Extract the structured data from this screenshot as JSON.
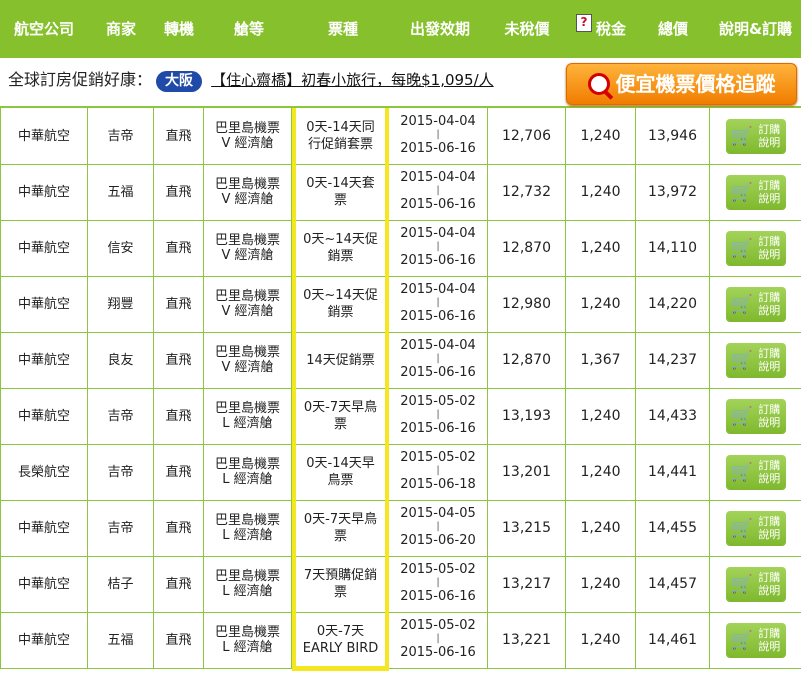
{
  "header": {
    "airline": "航空公司",
    "agent": "商家",
    "transfer": "轉機",
    "cabin": "艙等",
    "ticket_type": "票種",
    "validity": "出發效期",
    "pre_tax": "未稅價",
    "tax_icon": "?",
    "tax": "稅金",
    "total": "總價",
    "action": "說明&訂購"
  },
  "promo": {
    "prefix": "全球訂房促銷好康：",
    "city": "大阪",
    "link_text": "【住心齋橋】初春小旅行，每晚$1,095/人",
    "tracker_label": "便宜機票價格追蹤"
  },
  "accent": "#86c02c",
  "highlight_color": "#f5e71f",
  "rows": [
    {
      "airline": "中華航空",
      "agent": "吉帝",
      "transfer": "直飛",
      "cabin1": "巴里島機票",
      "cabin2": "V 經濟艙",
      "ticket": "0天-14天同行促銷套票",
      "from": "2015-04-04",
      "sep": "|",
      "to": "2015-06-16",
      "pre_tax": "12,706",
      "tax": "1,240",
      "total": "13,946",
      "btn_line1": "訂購",
      "btn_line2": "說明"
    },
    {
      "airline": "中華航空",
      "agent": "五福",
      "transfer": "直飛",
      "cabin1": "巴里島機票",
      "cabin2": "V 經濟艙",
      "ticket": "0天-14天套票",
      "from": "2015-04-04",
      "sep": "|",
      "to": "2015-06-16",
      "pre_tax": "12,732",
      "tax": "1,240",
      "total": "13,972",
      "btn_line1": "訂購",
      "btn_line2": "說明"
    },
    {
      "airline": "中華航空",
      "agent": "信安",
      "transfer": "直飛",
      "cabin1": "巴里島機票",
      "cabin2": "V 經濟艙",
      "ticket": "0天~14天促銷票",
      "from": "2015-04-04",
      "sep": "|",
      "to": "2015-06-16",
      "pre_tax": "12,870",
      "tax": "1,240",
      "total": "14,110",
      "btn_line1": "訂購",
      "btn_line2": "說明"
    },
    {
      "airline": "中華航空",
      "agent": "翔豐",
      "transfer": "直飛",
      "cabin1": "巴里島機票",
      "cabin2": "V 經濟艙",
      "ticket": "0天~14天促銷票",
      "from": "2015-04-04",
      "sep": "|",
      "to": "2015-06-16",
      "pre_tax": "12,980",
      "tax": "1,240",
      "total": "14,220",
      "btn_line1": "訂購",
      "btn_line2": "說明"
    },
    {
      "airline": "中華航空",
      "agent": "良友",
      "transfer": "直飛",
      "cabin1": "巴里島機票",
      "cabin2": "V 經濟艙",
      "ticket": "14天促銷票",
      "from": "2015-04-04",
      "sep": "|",
      "to": "2015-06-16",
      "pre_tax": "12,870",
      "tax": "1,367",
      "total": "14,237",
      "btn_line1": "訂購",
      "btn_line2": "說明"
    },
    {
      "airline": "中華航空",
      "agent": "吉帝",
      "transfer": "直飛",
      "cabin1": "巴里島機票",
      "cabin2": "L 經濟艙",
      "ticket": "0天-7天早鳥票",
      "from": "2015-05-02",
      "sep": "|",
      "to": "2015-06-16",
      "pre_tax": "13,193",
      "tax": "1,240",
      "total": "14,433",
      "btn_line1": "訂購",
      "btn_line2": "說明"
    },
    {
      "airline": "長榮航空",
      "agent": "吉帝",
      "transfer": "直飛",
      "cabin1": "巴里島機票",
      "cabin2": "L 經濟艙",
      "ticket": "0天-14天早鳥票",
      "from": "2015-05-02",
      "sep": "|",
      "to": "2015-06-18",
      "pre_tax": "13,201",
      "tax": "1,240",
      "total": "14,441",
      "btn_line1": "訂購",
      "btn_line2": "說明"
    },
    {
      "airline": "中華航空",
      "agent": "吉帝",
      "transfer": "直飛",
      "cabin1": "巴里島機票",
      "cabin2": "L 經濟艙",
      "ticket": "0天-7天早鳥票",
      "from": "2015-04-05",
      "sep": "|",
      "to": "2015-06-20",
      "pre_tax": "13,215",
      "tax": "1,240",
      "total": "14,455",
      "btn_line1": "訂購",
      "btn_line2": "說明"
    },
    {
      "airline": "中華航空",
      "agent": "桔子",
      "transfer": "直飛",
      "cabin1": "巴里島機票",
      "cabin2": "L 經濟艙",
      "ticket": "7天預購促銷票",
      "from": "2015-05-02",
      "sep": "|",
      "to": "2015-06-16",
      "pre_tax": "13,217",
      "tax": "1,240",
      "total": "14,457",
      "btn_line1": "訂購",
      "btn_line2": "說明"
    },
    {
      "airline": "中華航空",
      "agent": "五福",
      "transfer": "直飛",
      "cabin1": "巴里島機票",
      "cabin2": "L 經濟艙",
      "ticket": "0天-7天 EARLY BIRD",
      "from": "2015-05-02",
      "sep": "|",
      "to": "2015-06-16",
      "pre_tax": "13,221",
      "tax": "1,240",
      "total": "14,461",
      "btn_line1": "訂購",
      "btn_line2": "說明"
    }
  ]
}
